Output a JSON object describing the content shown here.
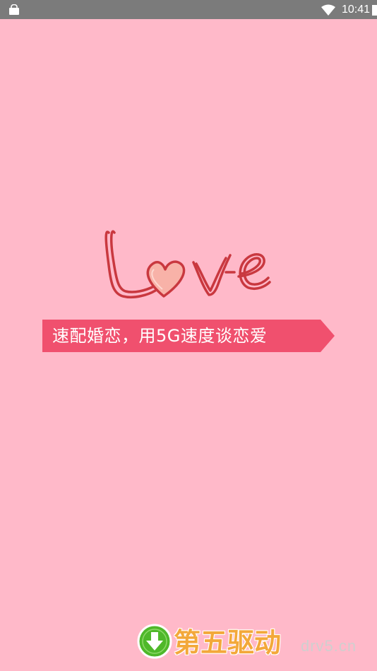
{
  "status_bar": {
    "time": "10:41",
    "icons": [
      "bag-icon",
      "wifi-icon",
      "battery-icon"
    ]
  },
  "splash": {
    "logo_text": "Love",
    "tagline": "速配婚恋，用5G速度谈恋爱"
  },
  "watermark": {
    "title": "第五驱动",
    "domain": "drv5.cn",
    "icon": "download-arrow-icon"
  },
  "colors": {
    "background": "#ffb9c9",
    "status_bar": "#7b7b7b",
    "banner": "#f0506e",
    "logo_stroke": "#c9383f",
    "heart_fill": "#f8b2a8",
    "watermark_orange": "#f3a83a",
    "watermark_green": "#4fb82a"
  }
}
